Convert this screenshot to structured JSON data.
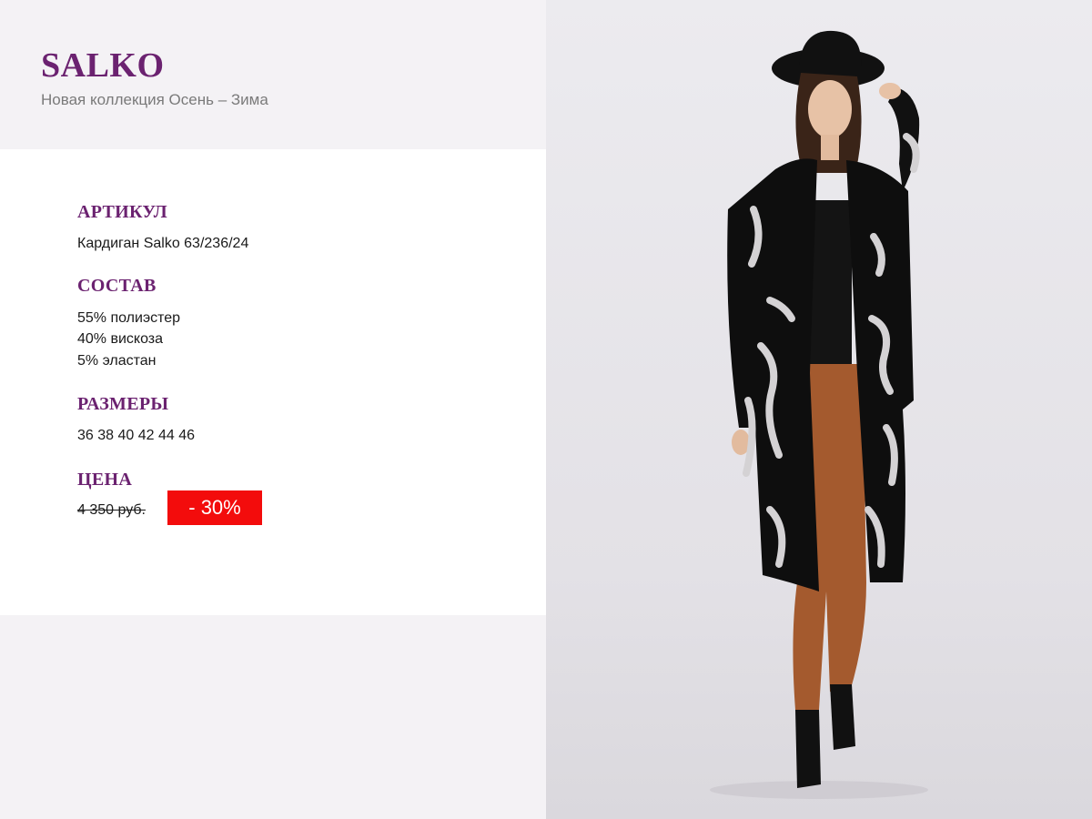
{
  "header": {
    "brand": "SALKO",
    "subtitle": "Новая коллекция Осень – Зима"
  },
  "product": {
    "article_label": "АРТИКУЛ",
    "article_value": "Кардиган Salko 63/236/24",
    "composition_label": "СОСТАВ",
    "composition": [
      "55% полиэстер",
      "40% вискоза",
      "5% эластан"
    ],
    "sizes_label": "РАЗМЕРЫ",
    "sizes_value": "36 38 40 42 44 46",
    "price_label": "ЦЕНА",
    "old_price": "4 350 руб.",
    "discount": "- 30%"
  },
  "colors": {
    "accent": "#6b2270",
    "discount_bg": "#f30c0c"
  }
}
